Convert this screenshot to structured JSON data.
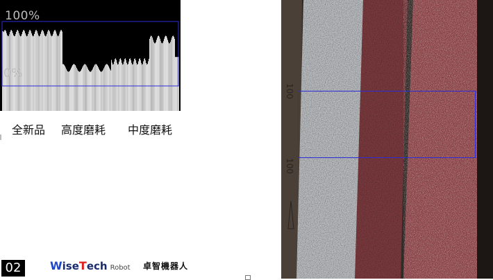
{
  "histogram": {
    "top_label": "100%",
    "bottom_label": "0%"
  },
  "labels": {
    "new": "全新品",
    "high_wear": "高度磨耗",
    "mid_wear": "中度磨耗"
  },
  "footer": {
    "page_number": "02",
    "logo_w": "W",
    "logo_ise": "ise",
    "logo_t": "T",
    "logo_ech": "ech",
    "logo_robot": "Robot",
    "company_cn": "卓智機器人"
  },
  "photo": {
    "grit_text": "100"
  },
  "colors": {
    "roi": "#2b2bd8",
    "plot_bg": "#000000",
    "logo_blue": "#1e46c8",
    "logo_red": "#e02020"
  }
}
